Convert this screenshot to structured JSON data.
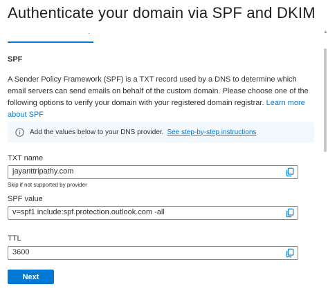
{
  "dialog": {
    "title": "Authenticate your domain via SPF and DKIM"
  },
  "tab": {
    "stub_text": "."
  },
  "spf": {
    "heading": "SPF",
    "description": "A Sender Policy Framework (SPF) is a TXT record used by a DNS to determine which email servers can send emails on behalf of the custom domain. Please choose one of the following options to verify your domain with your registered domain registrar.",
    "learn_more_link": "Learn more about SPF"
  },
  "info": {
    "icon": "info-icon",
    "text": "Add the values below to your DNS provider.",
    "link": "See step-by-step instructions"
  },
  "fields": {
    "txt_name": {
      "label": "TXT name",
      "value": "jayanttripathy.com",
      "helper": "Skip if not supported by provider"
    },
    "spf_value": {
      "label": "SPF value",
      "value": "v=spf1 include:spf.protection.outlook.com -all"
    },
    "ttl": {
      "label": "TTL",
      "value": "3600"
    }
  },
  "footer": {
    "next_label": "Next"
  },
  "colors": {
    "accent": "#0078d4",
    "info_bg": "#f3f8fc",
    "text": "#323130"
  }
}
